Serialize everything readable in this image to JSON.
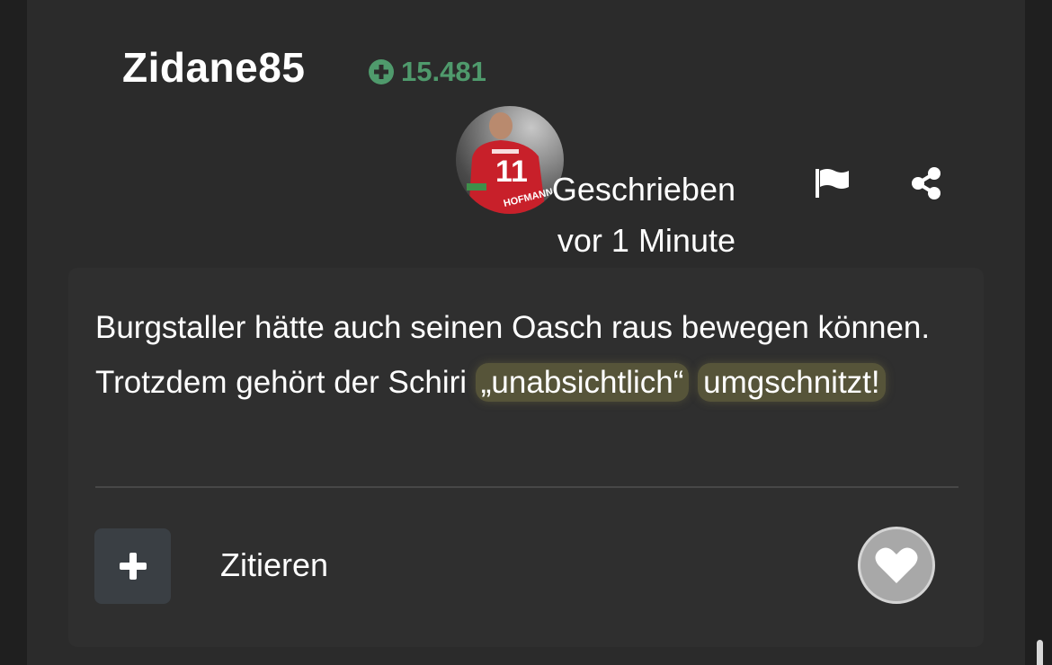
{
  "author": {
    "username": "Zidane85",
    "reputation": "15.481",
    "reputation_icon": "plus-circle-icon",
    "reputation_color": "#4f9a6c"
  },
  "post_meta": {
    "written_label": "Geschrieben",
    "time_ago": "vor 1 Minute",
    "flag_icon": "flag-icon",
    "share_icon": "share-icon"
  },
  "post": {
    "text_part1": "Burgstaller hätte auch seinen Oasch raus bewegen können. Trotzdem gehört der Schiri ",
    "text_highlight1": "„unabsichtlich“",
    "text_space": " ",
    "text_highlight2": "umgschnitzt!",
    "highlight_color": "#878246"
  },
  "actions": {
    "quote_label": "Zitieren",
    "add_icon": "plus-icon",
    "like_icon": "heart-icon"
  }
}
